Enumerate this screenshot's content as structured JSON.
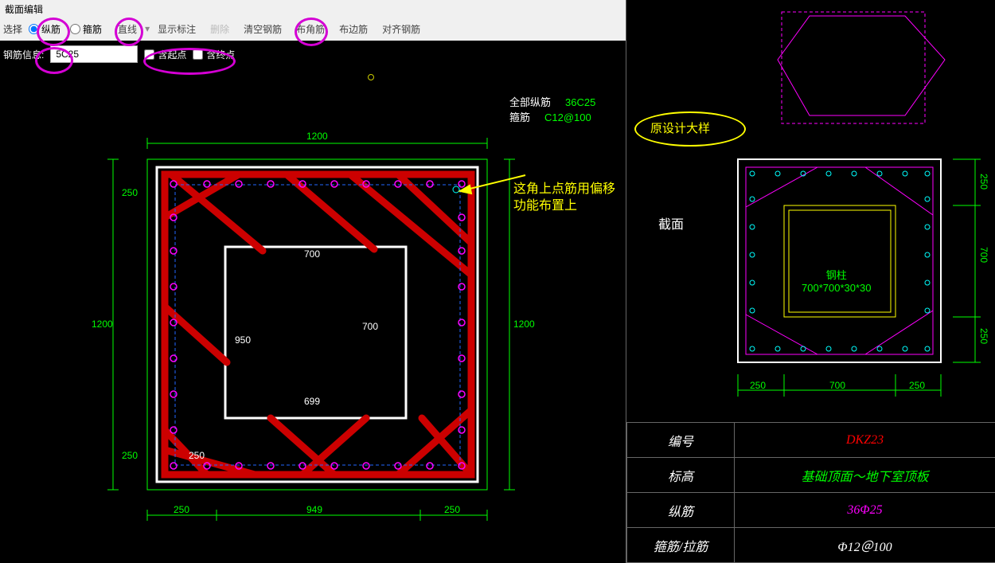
{
  "window": {
    "title": "截面编辑"
  },
  "toolbar": {
    "group_label": "选择",
    "radio1": "纵筋",
    "radio2": "箍筋",
    "btn_line": "直线",
    "btn_dim": "显示标注",
    "btn_delete": "删除",
    "btn_clear": "清空钢筋",
    "btn_corner": "布角筋",
    "btn_edge": "布边筋",
    "btn_align": "对齐钢筋"
  },
  "toolbar2": {
    "label": "钢筋信息:",
    "value": "5C25",
    "chk1": "含起点",
    "chk2": "含终点"
  },
  "legend": {
    "row1_label": "全部纵筋",
    "row1_value": "36C25",
    "row2_label": "箍筋",
    "row2_value": "C12@100"
  },
  "annotate": {
    "line1": "这角上点筋用偏移",
    "line2": "功能布置上",
    "original": "原设计大样",
    "section": "截面",
    "steel_col1": "钢柱",
    "steel_col2": "700*700*30*30"
  },
  "dims_left": {
    "top": "1200",
    "left_out": "1200",
    "right_out": "1200",
    "left_upper": "250",
    "left_lower": "250",
    "inner_top": "700",
    "inner_leftmid": "700",
    "inner_left": "950",
    "inner_bottom": "699",
    "bottom_seg1": "250",
    "bottom_seg2": "949",
    "bottom_dup": "250"
  },
  "dims_right": {
    "top_r1": "250",
    "mid_r": "700",
    "bot_r1": "250",
    "bot_seg1": "250",
    "bot_seg2": "700",
    "bot_seg3": "250"
  },
  "table": {
    "r1l": "编号",
    "r1v": "DKZ23",
    "r2l": "标高",
    "r2v": "基础顶面～地下室顶板",
    "r3l": "纵筋",
    "r3v": "36Φ25",
    "r4l": "箍筋/拉筋",
    "r4v": "Φ12＠100"
  }
}
